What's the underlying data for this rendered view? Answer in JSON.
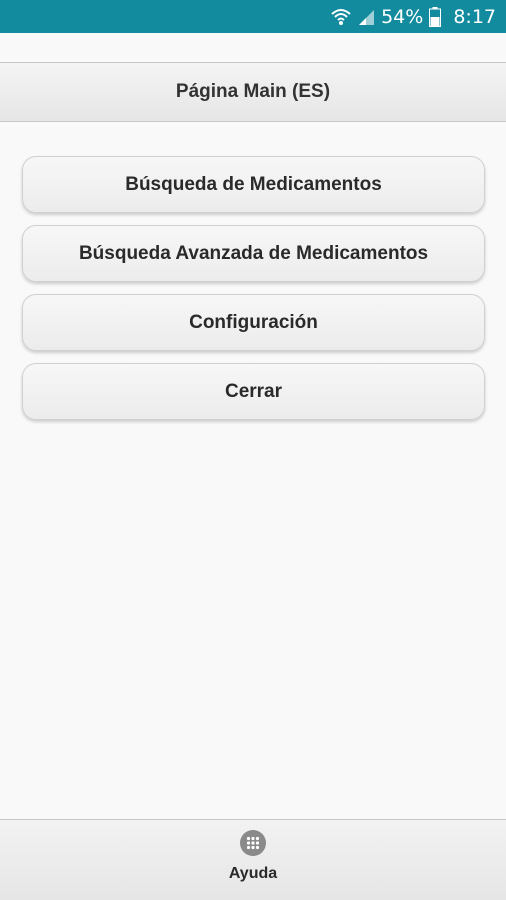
{
  "status_bar": {
    "battery": "54%",
    "time": "8:17",
    "icons": [
      "wifi-icon",
      "signal-icon",
      "battery-icon"
    ],
    "background_color": "#138b9f"
  },
  "header": {
    "title": "Página Main (ES)"
  },
  "menu": {
    "items": [
      {
        "label": "Búsqueda de Medicamentos"
      },
      {
        "label": "Búsqueda Avanzada de Medicamentos"
      },
      {
        "label": "Configuración"
      },
      {
        "label": "Cerrar"
      }
    ]
  },
  "footer": {
    "help_label": "Ayuda",
    "help_icon": "grid-icon"
  }
}
